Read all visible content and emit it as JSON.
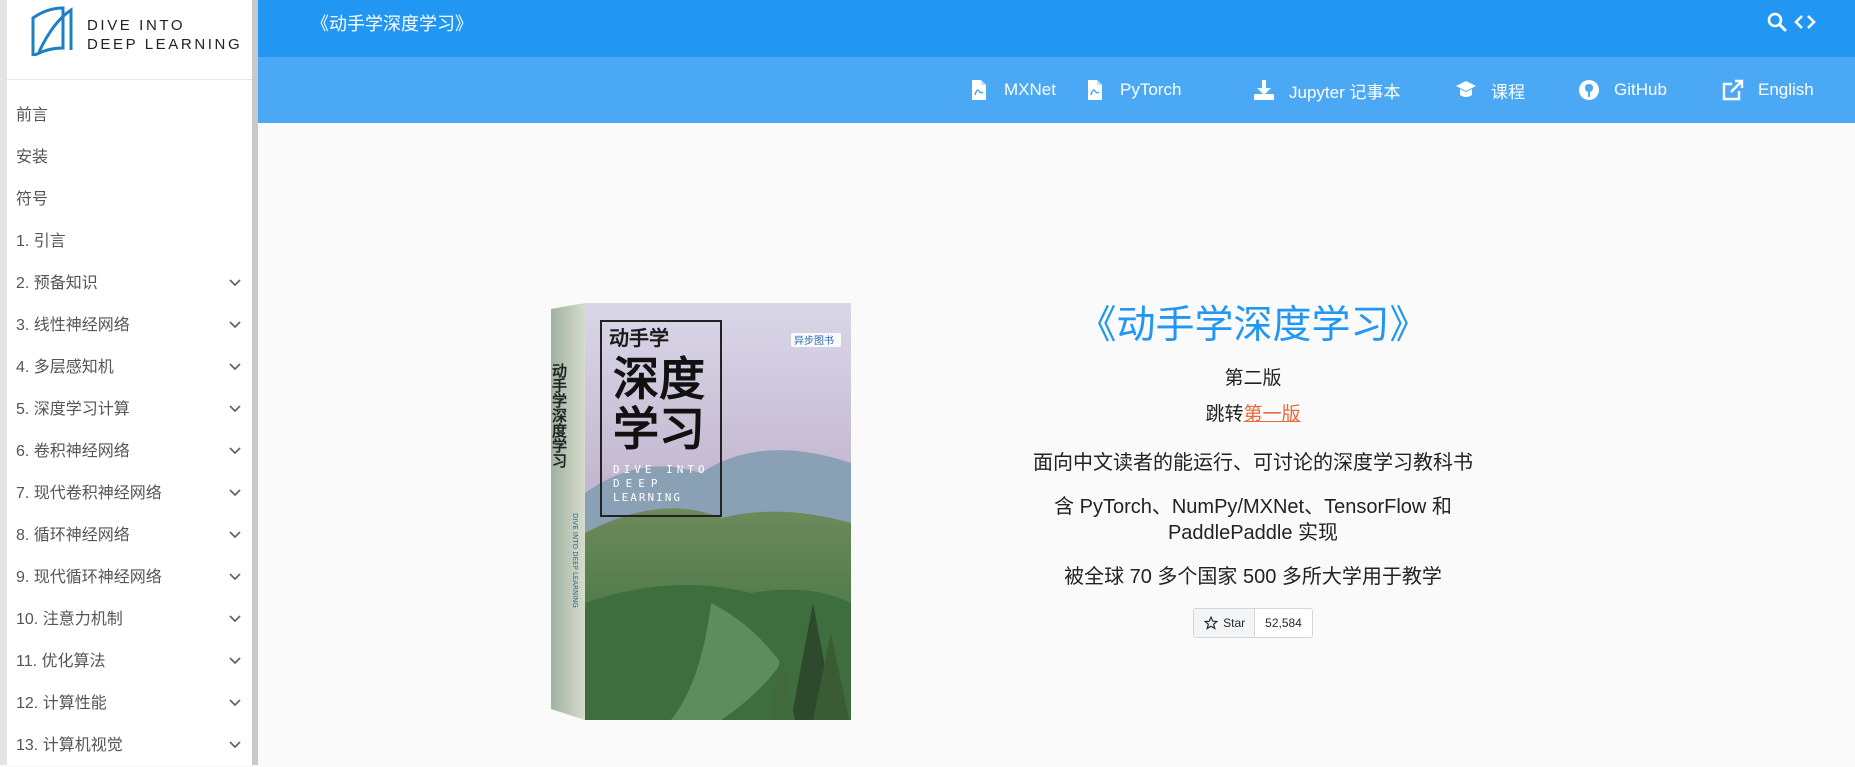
{
  "logo": {
    "line1": "DIVE INTO",
    "line2": "DEEP LEARNING"
  },
  "sidebar": {
    "items": [
      {
        "label": "前言",
        "expandable": false
      },
      {
        "label": "安装",
        "expandable": false
      },
      {
        "label": "符号",
        "expandable": false
      },
      {
        "label": "1. 引言",
        "expandable": false
      },
      {
        "label": "2. 预备知识",
        "expandable": true
      },
      {
        "label": "3. 线性神经网络",
        "expandable": true
      },
      {
        "label": "4. 多层感知机",
        "expandable": true
      },
      {
        "label": "5. 深度学习计算",
        "expandable": true
      },
      {
        "label": "6. 卷积神经网络",
        "expandable": true
      },
      {
        "label": "7. 现代卷积神经网络",
        "expandable": true
      },
      {
        "label": "8. 循环神经网络",
        "expandable": true
      },
      {
        "label": "9. 现代循环神经网络",
        "expandable": true
      },
      {
        "label": "10. 注意力机制",
        "expandable": true
      },
      {
        "label": "11. 优化算法",
        "expandable": true
      },
      {
        "label": "12. 计算性能",
        "expandable": true
      },
      {
        "label": "13. 计算机视觉",
        "expandable": true
      }
    ]
  },
  "header": {
    "title": "《动手学深度学习》",
    "icons": [
      "search-icon",
      "code-icon"
    ]
  },
  "nav": {
    "links": [
      {
        "label": "MXNet",
        "icon": "pdf-file-icon"
      },
      {
        "label": "PyTorch",
        "icon": "pdf-file-icon"
      },
      {
        "label": "Jupyter 记事本",
        "icon": "download-icon"
      },
      {
        "label": "课程",
        "icon": "graduation-cap-icon"
      },
      {
        "label": "GitHub",
        "icon": "github-icon"
      },
      {
        "label": "English",
        "icon": "external-link-icon"
      }
    ]
  },
  "cover": {
    "publisher_badge": "异步图书",
    "title_small": "动手学",
    "title_big_1": "深度",
    "title_big_2": "学习",
    "english": [
      "DIVE INTO",
      "DEEP",
      "LEARNING"
    ],
    "spine_title": "动手学深度学习",
    "spine_english": "DIVE INTO DEEP LEARNING"
  },
  "hero": {
    "title": "《动手学深度学习》",
    "edition": "第二版",
    "jump_prefix": "跳转",
    "jump_link": "第一版",
    "line1": "面向中文读者的能运行、可讨论的深度学习教科书",
    "line2": "含 PyTorch、NumPy/MXNet、TensorFlow 和 PaddlePaddle 实现",
    "line3": "被全球 70 多个国家 500 多所大学用于教学",
    "star_label": "Star",
    "star_count": "52,584"
  },
  "colors": {
    "header_blue": "#2196f3",
    "subbar_blue": "#4aa8f5",
    "link_orange": "#e8693b",
    "logo_teal": "#1f7fc4"
  }
}
